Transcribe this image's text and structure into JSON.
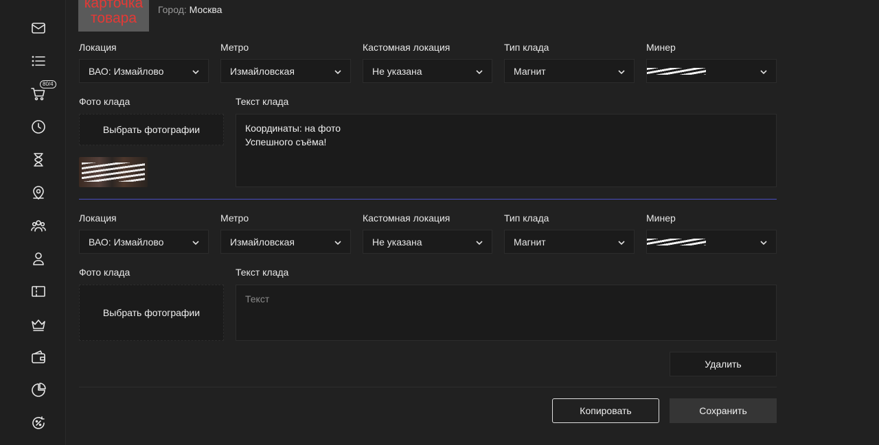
{
  "product": {
    "image_text": "карточка товара",
    "city_label": "Город:",
    "city_value": "Москва"
  },
  "sidebar": {
    "icons": [
      "mail-icon",
      "list-icon",
      "cart-icon",
      "clock-icon",
      "hourglass-icon",
      "location-pin-icon",
      "users-group-icon",
      "user-icon",
      "ticket-icon",
      "crown-icon",
      "wallet-icon",
      "pie-chart-icon",
      "percent-refresh-icon"
    ],
    "cart_badge": "80/4"
  },
  "form1": {
    "location_label": "Локация",
    "location_value": "ВАО: Измайлово",
    "metro_label": "Метро",
    "metro_value": "Измайловская",
    "custom_label": "Кастомная локация",
    "custom_value": "Не указана",
    "type_label": "Тип клада",
    "type_value": "Магнит",
    "miner_label": "Минер",
    "photo_label": "Фото клада",
    "photo_button": "Выбрать фотографии",
    "text_label": "Текст клада",
    "text_line1": "Координаты: на фото",
    "text_line2": "Успешного съёма!"
  },
  "form2": {
    "location_label": "Локация",
    "location_value": "ВАО: Измайлово",
    "metro_label": "Метро",
    "metro_value": "Измайловская",
    "custom_label": "Кастомная локация",
    "custom_value": "Не указана",
    "type_label": "Тип клада",
    "type_value": "Магнит",
    "miner_label": "Минер",
    "photo_label": "Фото клада",
    "photo_button": "Выбрать фотографии",
    "text_label": "Текст клада",
    "text_placeholder": "Текст",
    "delete_button": "Удалить"
  },
  "actions": {
    "copy_button": "Копировать",
    "save_button": "Сохранить"
  },
  "colors": {
    "background": "#212121",
    "field": "#1b1b1b",
    "divider_accent": "#4a4fc4",
    "image_text": "#e53935"
  }
}
